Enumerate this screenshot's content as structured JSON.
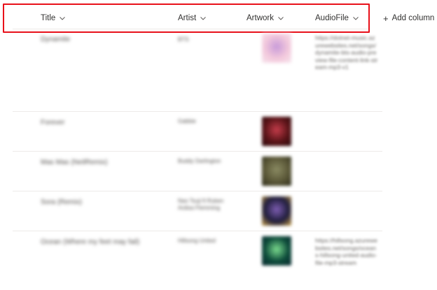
{
  "columns": [
    {
      "label": "Title"
    },
    {
      "label": "Artist"
    },
    {
      "label": "Artwork"
    },
    {
      "label": "AudioFile"
    }
  ],
  "add_column_label": "Add column",
  "rows": [
    {
      "title": "Dynamite",
      "artist": "BTS",
      "artwork_colors": [
        "#f3c9dc",
        "#c89bd9",
        "#f7e6ee"
      ],
      "audio": "https://dotnet-music.azurewebsites.net/songs/dynamite-bts-audio-preview-file-content-link-stream-mp3-v1"
    },
    {
      "title": "Forever",
      "artist": "Gabbie",
      "artwork_colors": [
        "#5a1418",
        "#c43c4a",
        "#2a0a0c"
      ],
      "audio": ""
    },
    {
      "title": "Mas Mas (NeilRemix)",
      "artist": "Buddy Darlington",
      "artwork_colors": [
        "#5b5838",
        "#8a8a62",
        "#2f2e1c"
      ],
      "audio": ""
    },
    {
      "title": "Sora (Remix)",
      "artist": "Nao Tsuji ft Ruben Ardisa Flemming",
      "artwork_colors": [
        "#1f1d3b",
        "#7d5db2",
        "#caa24a"
      ],
      "audio": ""
    },
    {
      "title": "Ocean (Where my feet may fail)",
      "artist": "Hillsong United",
      "artwork_colors": [
        "#0d4b3a",
        "#7bdc8e",
        "#0a2a30"
      ],
      "audio": "https://hillsong.azurewebsites.net/songs/oceans-hillsong-united-audio-file-mp3-stream"
    }
  ]
}
